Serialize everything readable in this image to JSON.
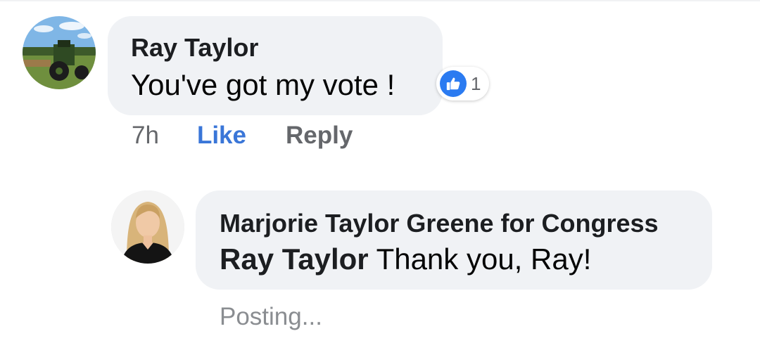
{
  "comments": [
    {
      "author": "Ray Taylor",
      "text": "You've got my vote !",
      "reaction_count": "1",
      "time": "7h",
      "like_label": "Like",
      "reply_label": "Reply"
    },
    {
      "author": "Marjorie Taylor Greene for Congress",
      "mention": "Ray Taylor",
      "text": "Thank you, Ray!",
      "status": "Posting..."
    }
  ],
  "colors": {
    "bubble": "#f0f2f5",
    "like_blue": "#2b7bf1",
    "link_blue": "#3a76d8",
    "meta_gray": "#65676b"
  }
}
